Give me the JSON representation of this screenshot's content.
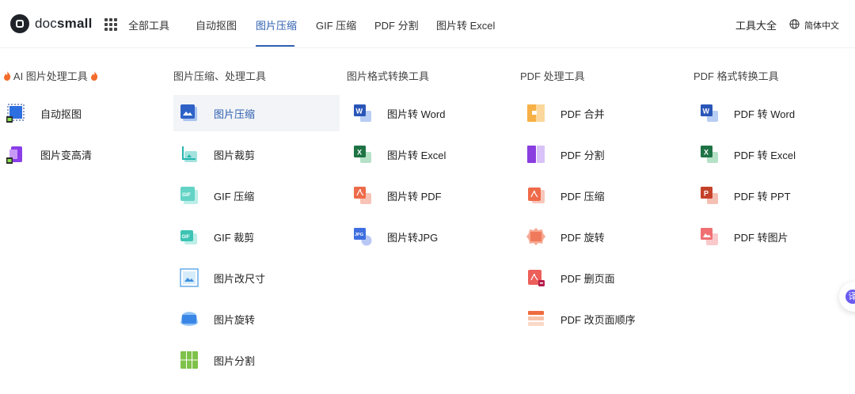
{
  "brand": {
    "part1": "doc",
    "part2": "small"
  },
  "nav": {
    "all_tools": "全部工具",
    "items": [
      "自动抠图",
      "图片压缩",
      "GIF 压缩",
      "PDF 分割",
      "图片转 Excel"
    ],
    "active": "图片压缩",
    "tools_hub": "工具大全",
    "language": "简体中文"
  },
  "columns": [
    {
      "title": "AI 图片处理工具",
      "items": [
        {
          "label": "自动抠图",
          "icon": "ai-cutout-icon"
        },
        {
          "label": "图片变高清",
          "icon": "ai-enhance-icon"
        }
      ]
    },
    {
      "title": "图片压缩、处理工具",
      "items": [
        {
          "label": "图片压缩",
          "icon": "image-compress-icon",
          "active": true
        },
        {
          "label": "图片裁剪",
          "icon": "image-crop-icon"
        },
        {
          "label": "GIF 压缩",
          "icon": "gif-compress-icon"
        },
        {
          "label": "GIF 裁剪",
          "icon": "gif-crop-icon"
        },
        {
          "label": "图片改尺寸",
          "icon": "image-resize-icon"
        },
        {
          "label": "图片旋转",
          "icon": "image-rotate-icon"
        },
        {
          "label": "图片分割",
          "icon": "image-split-icon"
        }
      ]
    },
    {
      "title": "图片格式转换工具",
      "items": [
        {
          "label": "图片转 Word",
          "icon": "image-to-word-icon"
        },
        {
          "label": "图片转 Excel",
          "icon": "image-to-excel-icon"
        },
        {
          "label": "图片转 PDF",
          "icon": "image-to-pdf-icon"
        },
        {
          "label": "图片转JPG",
          "icon": "image-to-jpg-icon"
        }
      ]
    },
    {
      "title": "PDF 处理工具",
      "items": [
        {
          "label": "PDF 合并",
          "icon": "pdf-merge-icon"
        },
        {
          "label": "PDF 分割",
          "icon": "pdf-split-icon"
        },
        {
          "label": "PDF 压缩",
          "icon": "pdf-compress-icon"
        },
        {
          "label": "PDF 旋转",
          "icon": "pdf-rotate-icon"
        },
        {
          "label": "PDF 删页面",
          "icon": "pdf-delete-pages-icon"
        },
        {
          "label": "PDF 改页面顺序",
          "icon": "pdf-reorder-icon"
        }
      ]
    },
    {
      "title": "PDF 格式转换工具",
      "items": [
        {
          "label": "PDF 转 Word",
          "icon": "pdf-to-word-icon"
        },
        {
          "label": "PDF 转 Excel",
          "icon": "pdf-to-excel-icon"
        },
        {
          "label": "PDF 转 PPT",
          "icon": "pdf-to-ppt-icon"
        },
        {
          "label": "PDF 转图片",
          "icon": "pdf-to-image-icon"
        }
      ]
    }
  ],
  "float_button": {
    "glyph": "译"
  },
  "colors": {
    "accent": "#2f5fb0",
    "hover_bg": "#f2f4f7"
  }
}
